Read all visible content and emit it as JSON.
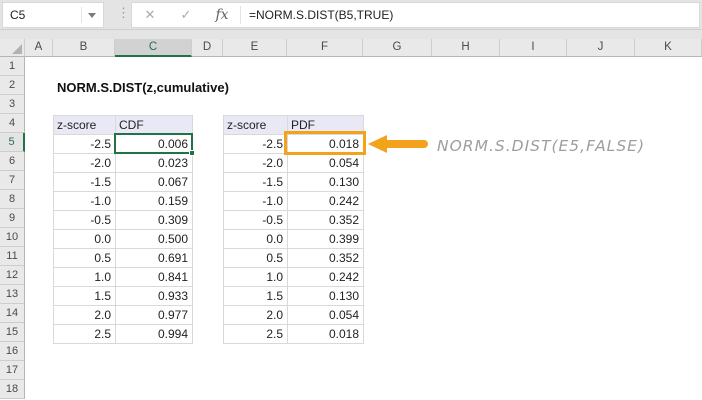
{
  "formula_bar": {
    "name_box": "C5",
    "dots_icon": "⋮",
    "cancel_icon": "✕",
    "enter_icon": "✓",
    "fx_icon": "fx",
    "formula": "=NORM.S.DIST(B5,TRUE)"
  },
  "grid": {
    "column_headers": [
      "A",
      "B",
      "C",
      "D",
      "E",
      "F",
      "G",
      "H",
      "I",
      "J",
      "K"
    ],
    "selected_column": "C",
    "row_headers": [
      "1",
      "2",
      "3",
      "4",
      "5",
      "6",
      "7",
      "8",
      "9",
      "10",
      "11",
      "12",
      "13",
      "14",
      "15",
      "16",
      "17",
      "18"
    ],
    "selected_row": "5",
    "selected_cell": "C5",
    "highlighted_cell": "F5"
  },
  "sheet": {
    "title": "NORM.S.DIST(z,cumulative)",
    "cdf_table": {
      "headers": [
        "z-score",
        "CDF"
      ],
      "rows": [
        [
          "-2.5",
          "0.006"
        ],
        [
          "-2.0",
          "0.023"
        ],
        [
          "-1.5",
          "0.067"
        ],
        [
          "-1.0",
          "0.159"
        ],
        [
          "-0.5",
          "0.309"
        ],
        [
          "0.0",
          "0.500"
        ],
        [
          "0.5",
          "0.691"
        ],
        [
          "1.0",
          "0.841"
        ],
        [
          "1.5",
          "0.933"
        ],
        [
          "2.0",
          "0.977"
        ],
        [
          "2.5",
          "0.994"
        ]
      ]
    },
    "pdf_table": {
      "headers": [
        "z-score",
        "PDF"
      ],
      "rows": [
        [
          "-2.5",
          "0.018"
        ],
        [
          "-2.0",
          "0.054"
        ],
        [
          "-1.5",
          "0.130"
        ],
        [
          "-1.0",
          "0.242"
        ],
        [
          "-0.5",
          "0.352"
        ],
        [
          "0.0",
          "0.399"
        ],
        [
          "0.5",
          "0.352"
        ],
        [
          "1.0",
          "0.242"
        ],
        [
          "1.5",
          "0.130"
        ],
        [
          "2.0",
          "0.054"
        ],
        [
          "2.5",
          "0.018"
        ]
      ]
    }
  },
  "annotation": {
    "text": "NORM.S.DIST(E5,FALSE)"
  },
  "colors": {
    "selection_green": "#217346",
    "highlight_orange": "#f2a21b",
    "table_header_fill": "#e9e9f5"
  }
}
